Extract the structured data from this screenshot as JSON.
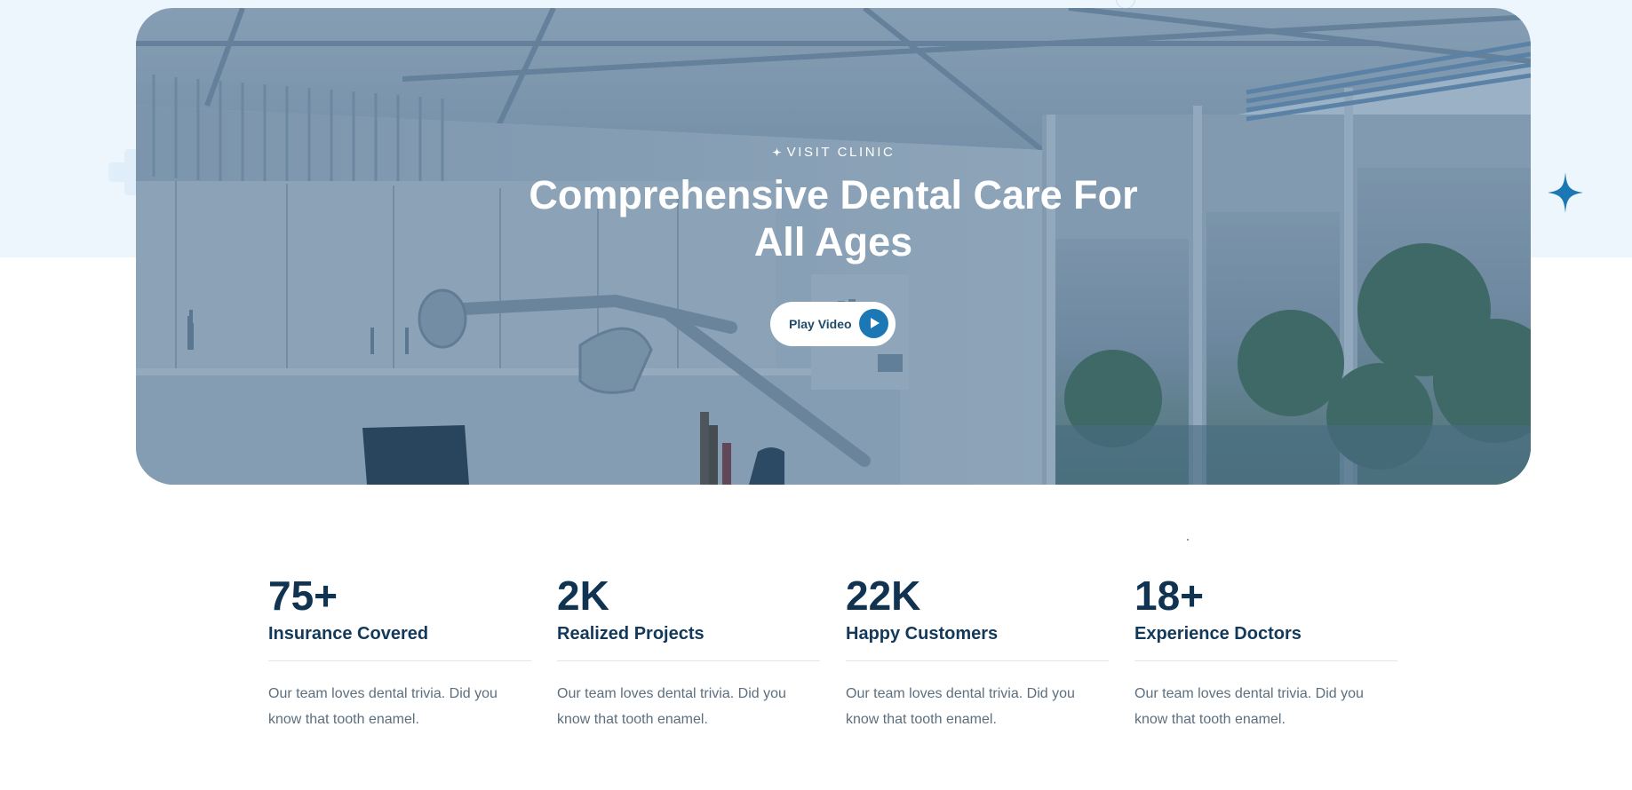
{
  "hero": {
    "eyebrow": "VISIT CLINIC",
    "title": "Comprehensive Dental Care For All Ages",
    "play_button_label": "Play Video"
  },
  "stats": [
    {
      "value": "75+",
      "label": "Insurance Covered",
      "description": "Our team loves dental trivia. Did you know that tooth enamel."
    },
    {
      "value": "2K",
      "label": "Realized Projects",
      "description": "Our team loves dental trivia. Did you know that tooth enamel."
    },
    {
      "value": "22K",
      "label": "Happy Customers",
      "description": "Our team loves dental trivia. Did you know that tooth enamel."
    },
    {
      "value": "18+",
      "label": "Experience Doctors",
      "description": "Our team loves dental trivia. Did you know that tooth enamel."
    }
  ],
  "colors": {
    "accent": "#1b78b4",
    "heading": "#0f3350",
    "body_text": "#5d6f7e",
    "top_band": "#eef6fd"
  },
  "icons": {
    "eyebrow": "sparkle-icon",
    "decor_right": "sparkle-icon",
    "decor_left": "plus-shape",
    "play": "play-icon"
  }
}
